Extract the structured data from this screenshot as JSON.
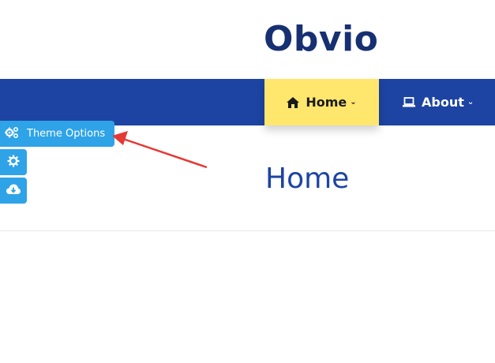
{
  "brand": {
    "name": "Obvio"
  },
  "nav": {
    "items": [
      {
        "label": "Home",
        "icon": "home-icon",
        "active": true
      },
      {
        "label": "About",
        "icon": "laptop-icon",
        "active": false
      }
    ]
  },
  "main": {
    "title": "Home"
  },
  "theme_panel": {
    "label": "Theme Options",
    "buttons": [
      {
        "icon": "gear-icon"
      },
      {
        "icon": "cloud-download-icon"
      }
    ]
  },
  "colors": {
    "nav_bg": "#1d44a2",
    "nav_active_bg": "#ffe66d",
    "brand_text": "#173072",
    "title_text": "#1d44a2",
    "theme_button": "#2ea3e8",
    "annotation_arrow": "#e53935"
  }
}
